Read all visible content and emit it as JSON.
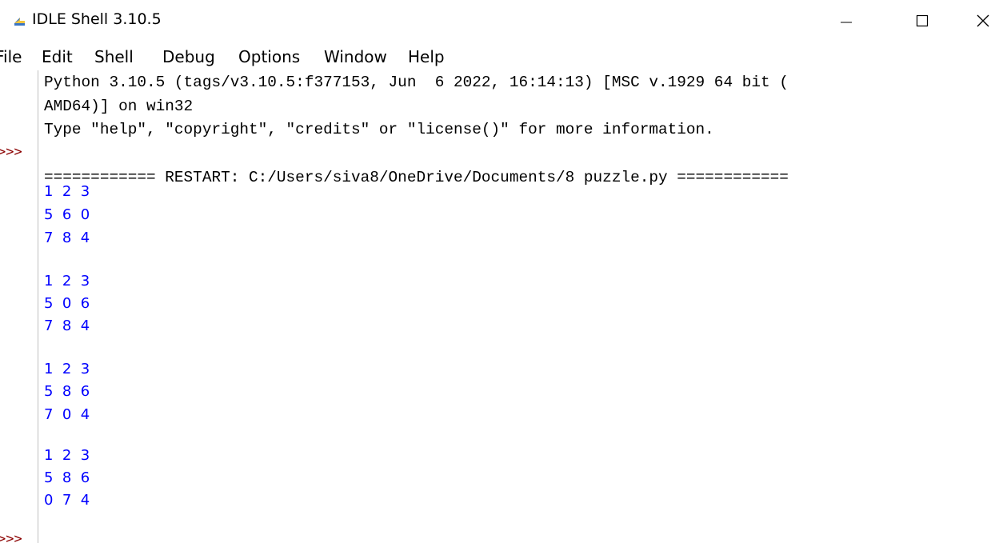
{
  "window": {
    "title": "IDLE Shell 3.10.5",
    "min_glyph": "—",
    "max_glyph": "☐",
    "close_glyph": "✕"
  },
  "menu": [
    "File",
    "Edit",
    "Shell",
    "Debug",
    "Options",
    "Window",
    "Help"
  ],
  "shell": {
    "banner_line1": "Python 3.10.5 (tags/v3.10.5:f377153, Jun  6 2022, 16:14:13) [MSC v.1929 64 bit (",
    "banner_line2": "AMD64)] on win32",
    "banner_line3": "Type \"help\", \"copyright\", \"credits\" or \"license()\" for more information.",
    "prompt": ">>>",
    "restart_line": "============ RESTART: C:/Users/siva8/OneDrive/Documents/8 puzzle.py ============",
    "output_lines": [
      "1  2  3",
      "5  6  0",
      "7  8  4",
      "",
      "1  2  3",
      "5  0  6",
      "7  8  4",
      "",
      "1  2  3",
      "5  8  6",
      "7  0  4",
      "",
      "1  2  3",
      "5  8  6",
      "0  7  4"
    ]
  },
  "colors": {
    "stdout": "#0000ff",
    "prompt": "#8b0000",
    "text": "#000000"
  }
}
